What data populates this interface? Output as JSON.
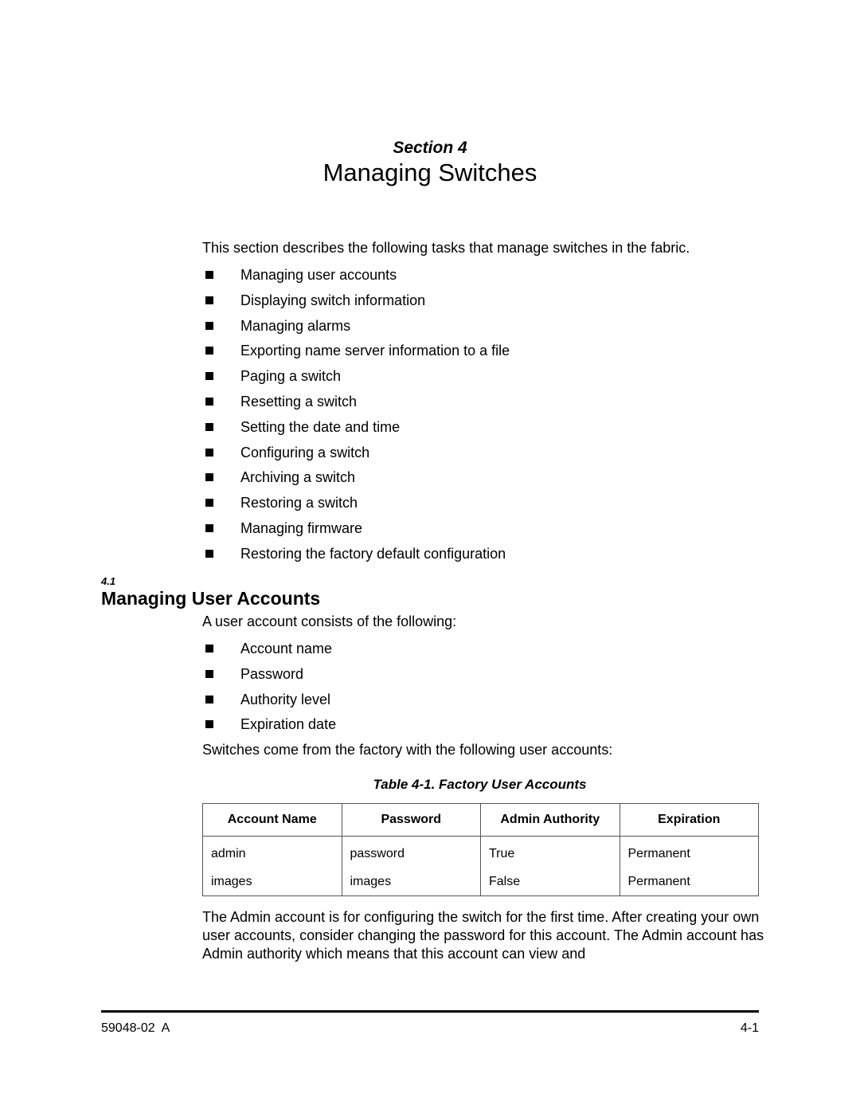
{
  "header": {
    "section_label": "Section 4",
    "title": "Managing Switches"
  },
  "intro": {
    "text": "This section describes the following tasks that manage switches in the fabric.",
    "bullet_icon": "black-square-bullet",
    "tasks": [
      "Managing user accounts",
      "Displaying switch information",
      "Managing alarms",
      "Exporting name server information to a file",
      "Paging a switch",
      "Resetting a switch",
      "Setting the date and time",
      "Configuring a switch",
      "Archiving a switch",
      "Restoring a switch",
      "Managing firmware",
      "Restoring the factory default configuration"
    ]
  },
  "subsection": {
    "number": "4.1",
    "title": "Managing User Accounts",
    "lead": "A user account consists of the following:",
    "items": [
      "Account name",
      "Password",
      "Authority level",
      "Expiration date"
    ],
    "table_intro": "Switches come from the factory with the following user accounts:"
  },
  "table": {
    "caption": "Table 4-1. Factory User Accounts",
    "headers": [
      "Account Name",
      "Password",
      "Admin Authority",
      "Expiration"
    ],
    "rows": [
      [
        "admin",
        "password",
        "True",
        "Permanent"
      ],
      [
        "images",
        "images",
        "False",
        "Permanent"
      ]
    ]
  },
  "closing_paragraph": "The Admin account is for configuring the switch for the first time. After creating your own user accounts, consider changing the password for this account. The Admin account has Admin authority which means that this account can view and",
  "footer": {
    "doc_number": "59048-02  A",
    "page_number": "4-1"
  }
}
